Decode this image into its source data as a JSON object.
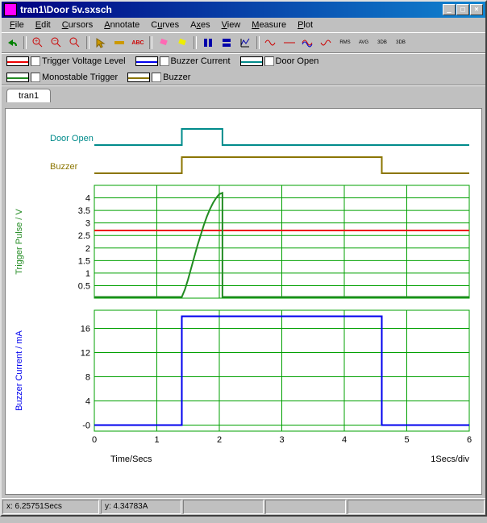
{
  "window": {
    "title": "tran1\\Door 5v.sxsch",
    "sysbtns": {
      "min": "_",
      "max": "□",
      "close": "×"
    }
  },
  "menu": {
    "file": "File",
    "edit": "Edit",
    "cursors": "Cursors",
    "annotate": "Annotate",
    "curves": "Curves",
    "axes": "Axes",
    "view": "View",
    "measure": "Measure",
    "plot": "Plot"
  },
  "legend": {
    "l1": "Trigger Voltage Level",
    "l2": "Buzzer Current",
    "l3": "Door Open",
    "l4": "Monostable Trigger",
    "l5": "Buzzer"
  },
  "tab": {
    "name": "tran1"
  },
  "colors": {
    "trigger_voltage_level": "#ee0000",
    "buzzer_current": "#0000ee",
    "door_open": "#008b8b",
    "monostable_trigger": "#228b22",
    "buzzer": "#8b7500",
    "grid": "#00a000"
  },
  "axes": {
    "x_label": "Time/Secs",
    "x_div": "1Secs/div",
    "y_trigger_label": "Trigger Pulse   / V",
    "y_buzzer_label": "Buzzer Current   / mA",
    "y_door_label": "Door Open",
    "y_buzz_strip": "Buzzer",
    "x_ticks": [
      "0",
      "1",
      "2",
      "3",
      "4",
      "5",
      "6"
    ],
    "y_trigger_ticks": [
      "0.5",
      "1",
      "1.5",
      "2",
      "2.5",
      "3",
      "3.5",
      "4"
    ],
    "y_buzzer_ticks": [
      "-0",
      "4",
      "8",
      "12",
      "16"
    ],
    "y_buzzer_tick_vals": [
      0,
      4,
      8,
      12,
      16
    ]
  },
  "status": {
    "x": "x: 6.25751Secs",
    "y": "y: 4.34783A"
  },
  "chart_data": [
    {
      "type": "line",
      "name": "Door Open (logic strip)",
      "x": [
        0,
        1.4,
        1.4,
        2.05,
        2.05,
        6
      ],
      "y": [
        0,
        0,
        1,
        1,
        0,
        0
      ],
      "ylim": [
        0,
        1
      ]
    },
    {
      "type": "line",
      "name": "Buzzer (logic strip)",
      "x": [
        0,
        1.4,
        1.4,
        4.6,
        4.6,
        6
      ],
      "y": [
        0,
        0,
        1,
        1,
        0,
        0
      ],
      "ylim": [
        0,
        1
      ]
    },
    {
      "type": "line",
      "name": "Trigger Voltage Level",
      "x": [
        0,
        6
      ],
      "y": [
        2.7,
        2.7
      ],
      "xlabel": "Time/Secs",
      "ylabel": "Trigger Pulse / V",
      "xlim": [
        0,
        6
      ],
      "ylim": [
        0,
        4.5
      ]
    },
    {
      "type": "line",
      "name": "Monostable Trigger",
      "x": [
        0,
        1.4,
        1.45,
        1.5,
        1.55,
        1.6,
        1.65,
        1.7,
        1.75,
        1.8,
        1.85,
        1.9,
        1.95,
        2.0,
        2.05,
        2.05,
        6
      ],
      "y": [
        0.05,
        0.05,
        0.35,
        0.75,
        1.2,
        1.65,
        2.1,
        2.5,
        2.9,
        3.25,
        3.55,
        3.8,
        4.0,
        4.15,
        4.2,
        0.05,
        0.05
      ],
      "xlabel": "Time/Secs",
      "ylabel": "Trigger Pulse / V",
      "xlim": [
        0,
        6
      ],
      "ylim": [
        0,
        4.5
      ]
    },
    {
      "type": "line",
      "name": "Buzzer Current",
      "x": [
        0,
        1.4,
        1.4,
        4.6,
        4.6,
        6
      ],
      "y": [
        0,
        0,
        18,
        18,
        0,
        0
      ],
      "xlabel": "Time/Secs",
      "ylabel": "Buzzer Current / mA",
      "xlim": [
        0,
        6
      ],
      "ylim": [
        -1,
        19
      ]
    }
  ]
}
